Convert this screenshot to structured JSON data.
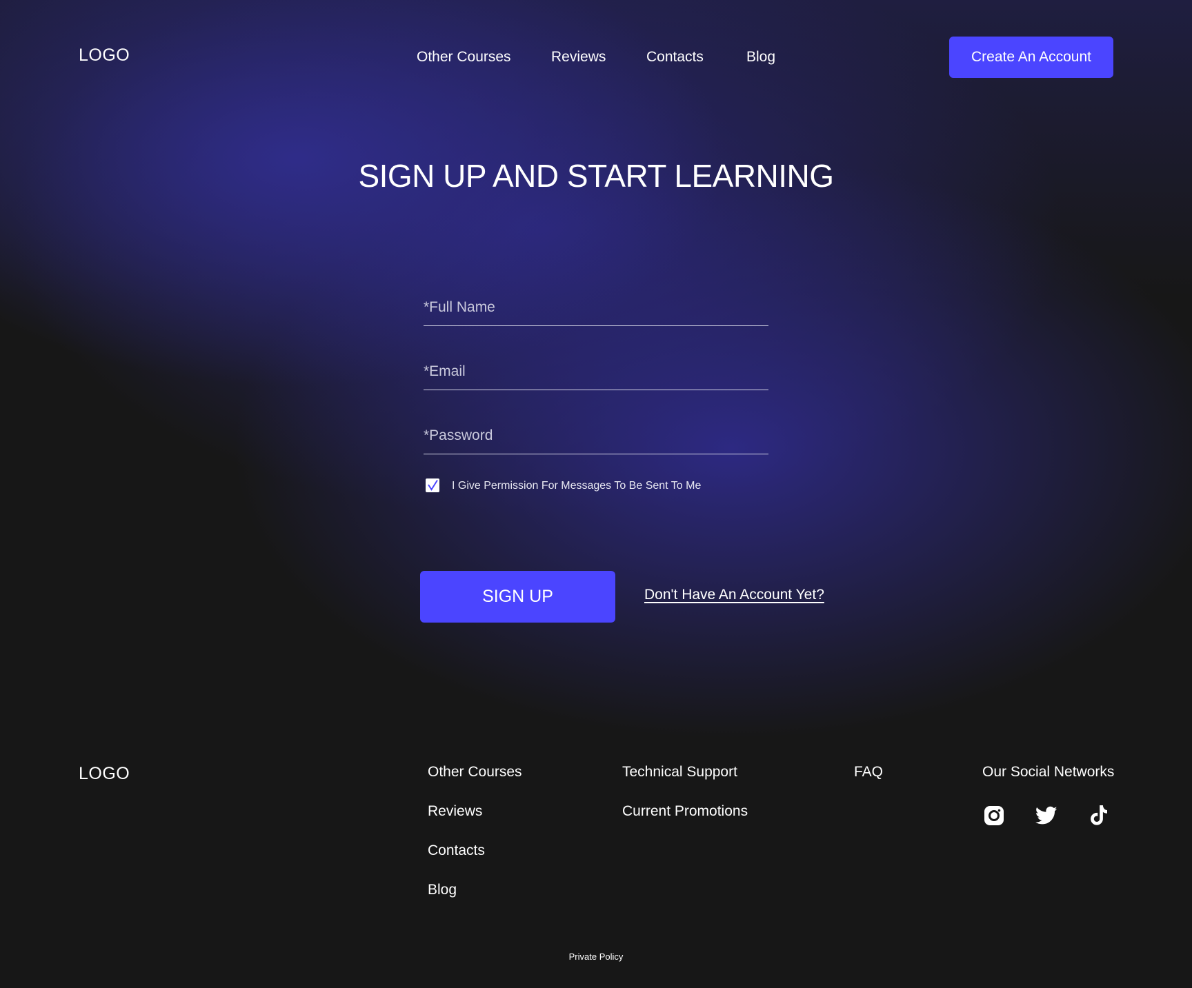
{
  "header": {
    "logo": "LOGO",
    "nav": [
      "Other Courses",
      "Reviews",
      "Contacts",
      "Blog"
    ],
    "cta_label": "Create An Account"
  },
  "hero": {
    "title": "SIGN UP AND START LEARNING"
  },
  "form": {
    "full_name_placeholder": "*Full Name",
    "email_placeholder": "*Email",
    "password_placeholder": "*Password",
    "consent_label": "I Give Permission For Messages To Be Sent To Me",
    "consent_checked": true,
    "submit_label": "SIGN UP",
    "account_link": "Don't Have An Account Yet?"
  },
  "footer": {
    "logo": "LOGO",
    "column1": [
      "Other Courses",
      "Reviews",
      "Contacts",
      "Blog"
    ],
    "column2": [
      "Technical Support",
      "Current Promotions"
    ],
    "column3": [
      "FAQ"
    ],
    "social_heading": "Our Social Networks",
    "social_icons": [
      "instagram-icon",
      "twitter-icon",
      "tiktok-icon"
    ],
    "policy": "Private Policy"
  },
  "colors": {
    "accent": "#4b45ff",
    "background": "#171717",
    "glow": "#2e2a87"
  }
}
